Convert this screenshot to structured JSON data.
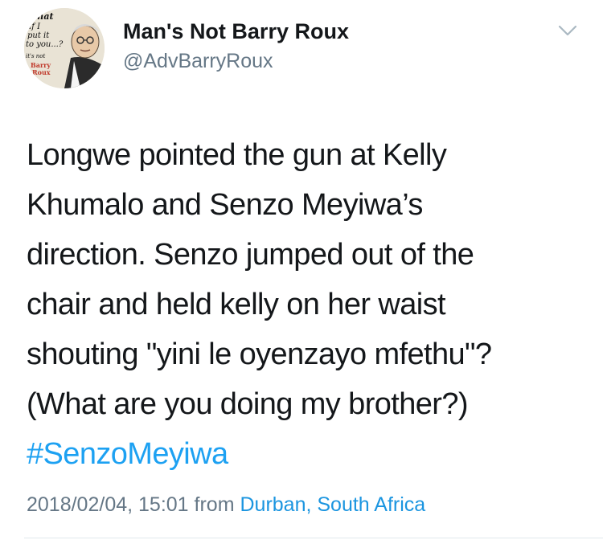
{
  "author": {
    "display_name": "Man's Not Barry Roux",
    "handle": "@AdvBarryRoux",
    "avatar_text": [
      "What",
      "if I",
      "put it",
      "to you...?",
      "it's not",
      "Barry",
      "Roux"
    ]
  },
  "tweet": {
    "lines": [
      "Longwe pointed the gun at Kelly",
      "Khumalo and Senzo Meyiwa’s",
      "direction. Senzo jumped out of the",
      "chair and held kelly on her waist",
      "shouting \"yini le oyenzayo mfethu\"?",
      "(What are you doing my brother?)"
    ],
    "hashtag": "#SenzoMeyiwa"
  },
  "meta": {
    "timestamp": "2018/02/04, 15:01",
    "from_label": "from",
    "location": "Durban, South Africa"
  },
  "icons": {
    "menu": "chevron-down-icon"
  },
  "colors": {
    "link": "#1da1f2",
    "muted": "#657786",
    "text": "#14171a"
  }
}
